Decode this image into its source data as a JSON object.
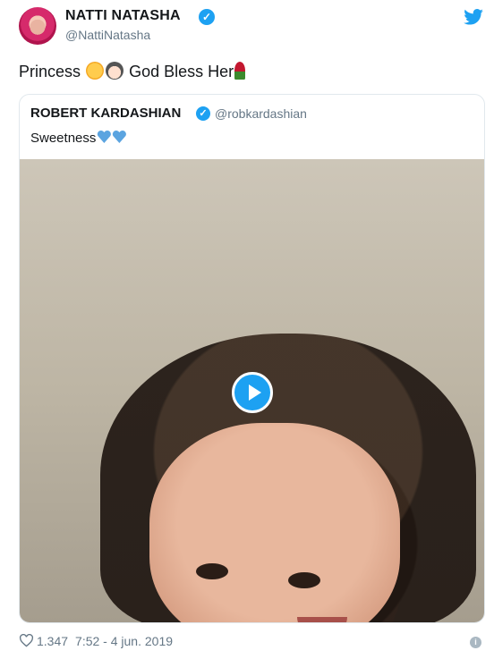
{
  "author": {
    "display_name": "NATTI NATASHA",
    "handle": "@NattiNatasha",
    "verified_icon": "verified-badge-icon"
  },
  "tweet": {
    "text_part1": "Princess",
    "text_part2": "God Bless Her",
    "emojis": [
      "relieved-face-emoji",
      "woman-emoji",
      "rose-emoji"
    ]
  },
  "quoted_tweet": {
    "display_name": "ROBERT KARDASHIAN",
    "handle": "@robkardashian",
    "text": "Sweetness",
    "emojis": [
      "blue-heart-emoji",
      "blue-heart-emoji"
    ]
  },
  "footer": {
    "likes": "1.347",
    "time": "7:52 - 4 jun. 2019"
  },
  "colors": {
    "twitter_blue": "#1da1f2",
    "secondary_text": "#657786",
    "border": "#e1e8ed"
  }
}
